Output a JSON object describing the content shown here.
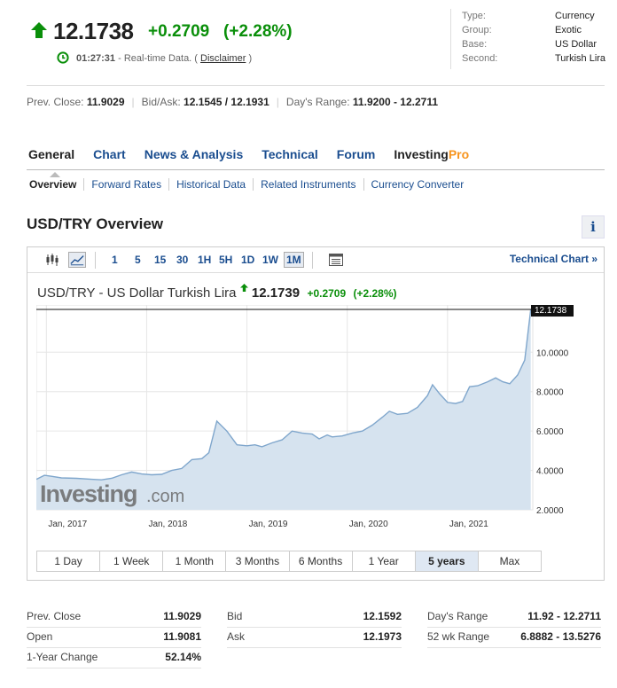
{
  "quote": {
    "price": "12.1738",
    "change": "+0.2709",
    "change_pct": "(+2.28%)",
    "time": "01:27:31",
    "realtime_text": "- Real-time Data. (",
    "disclaimer": "Disclaimer",
    "close_paren": ")",
    "up_color": "#0a8f0a"
  },
  "info": [
    {
      "k": "Type:",
      "v": "Currency"
    },
    {
      "k": "Group:",
      "v": "Exotic"
    },
    {
      "k": "Base:",
      "v": "US Dollar"
    },
    {
      "k": "Second:",
      "v": "Turkish Lira"
    }
  ],
  "stats_line": {
    "prev_close_label": "Prev. Close:",
    "prev_close": "11.9029",
    "bid_ask_label": "Bid/Ask:",
    "bid_ask": "12.1545 / 12.1931",
    "days_range_label": "Day's Range:",
    "days_range": "11.9200 - 12.2711"
  },
  "main_tabs": [
    "General",
    "Chart",
    "News & Analysis",
    "Technical",
    "Forum"
  ],
  "pro_tab": {
    "a": "Investing",
    "b": "Pro"
  },
  "sub_tabs": [
    "Overview",
    "Forward Rates",
    "Historical Data",
    "Related Instruments",
    "Currency Converter"
  ],
  "section_title": "USD/TRY Overview",
  "info_button": "i",
  "toolbar": {
    "timeframes": [
      "1",
      "5",
      "15",
      "30",
      "1H",
      "5H",
      "1D",
      "1W",
      "1M"
    ],
    "selected_timeframe": "1M",
    "technical_chart": "Technical Chart »"
  },
  "chart_title": {
    "name": "USD/TRY - US Dollar Turkish Lira",
    "price": "12.1739",
    "change": "+0.2709",
    "change_pct": "(+2.28%)"
  },
  "chart_data": {
    "type": "area",
    "title": "USD/TRY - US Dollar Turkish Lira",
    "x_ticks": [
      "Jan, 2017",
      "Jan, 2018",
      "Jan, 2019",
      "Jan, 2020",
      "Jan, 2021"
    ],
    "y_ticks": [
      "2.0000",
      "4.0000",
      "6.0000",
      "8.0000",
      "10.0000"
    ],
    "ylim": [
      2.0,
      12.4
    ],
    "xlim": [
      2016.9,
      2021.85
    ],
    "last_value_label": "12.1738",
    "last_value": 12.1738,
    "watermark": "Investing",
    "watermark_suffix": ".com",
    "grid": true,
    "fill_color": "#d6e3ef",
    "line_color": "#7fa6cc",
    "series": [
      {
        "values": [
          [
            2016.9,
            3.55
          ],
          [
            2016.98,
            3.75
          ],
          [
            2017.05,
            3.7
          ],
          [
            2017.15,
            3.62
          ],
          [
            2017.3,
            3.6
          ],
          [
            2017.45,
            3.55
          ],
          [
            2017.55,
            3.52
          ],
          [
            2017.65,
            3.6
          ],
          [
            2017.75,
            3.78
          ],
          [
            2017.85,
            3.92
          ],
          [
            2017.95,
            3.82
          ],
          [
            2018.05,
            3.78
          ],
          [
            2018.15,
            3.8
          ],
          [
            2018.25,
            4.0
          ],
          [
            2018.35,
            4.1
          ],
          [
            2018.45,
            4.55
          ],
          [
            2018.55,
            4.6
          ],
          [
            2018.62,
            4.9
          ],
          [
            2018.7,
            6.5
          ],
          [
            2018.8,
            6.0
          ],
          [
            2018.9,
            5.3
          ],
          [
            2019.0,
            5.25
          ],
          [
            2019.08,
            5.3
          ],
          [
            2019.15,
            5.2
          ],
          [
            2019.25,
            5.4
          ],
          [
            2019.35,
            5.55
          ],
          [
            2019.45,
            6.0
          ],
          [
            2019.55,
            5.9
          ],
          [
            2019.65,
            5.85
          ],
          [
            2019.72,
            5.6
          ],
          [
            2019.8,
            5.8
          ],
          [
            2019.85,
            5.7
          ],
          [
            2019.95,
            5.75
          ],
          [
            2020.05,
            5.9
          ],
          [
            2020.15,
            6.0
          ],
          [
            2020.25,
            6.3
          ],
          [
            2020.35,
            6.7
          ],
          [
            2020.42,
            7.0
          ],
          [
            2020.5,
            6.85
          ],
          [
            2020.6,
            6.9
          ],
          [
            2020.7,
            7.2
          ],
          [
            2020.8,
            7.8
          ],
          [
            2020.85,
            8.35
          ],
          [
            2020.92,
            7.9
          ],
          [
            2021.0,
            7.45
          ],
          [
            2021.08,
            7.4
          ],
          [
            2021.15,
            7.5
          ],
          [
            2021.22,
            8.25
          ],
          [
            2021.3,
            8.3
          ],
          [
            2021.4,
            8.5
          ],
          [
            2021.48,
            8.7
          ],
          [
            2021.55,
            8.5
          ],
          [
            2021.62,
            8.4
          ],
          [
            2021.7,
            8.85
          ],
          [
            2021.77,
            9.6
          ],
          [
            2021.83,
            12.17
          ]
        ]
      }
    ]
  },
  "range_buttons": [
    "1 Day",
    "1 Week",
    "1 Month",
    "3 Months",
    "6 Months",
    "1 Year",
    "5 years",
    "Max"
  ],
  "selected_range": "5 years",
  "bottom_stats": {
    "col1": [
      {
        "k": "Prev. Close",
        "v": "11.9029"
      },
      {
        "k": "Open",
        "v": "11.9081"
      },
      {
        "k": "1-Year Change",
        "v": "52.14%"
      }
    ],
    "col2": [
      {
        "k": "Bid",
        "v": "12.1592"
      },
      {
        "k": "Ask",
        "v": "12.1973"
      }
    ],
    "col3": [
      {
        "k": "Day's Range",
        "v": "11.92 - 12.2711"
      },
      {
        "k": "52 wk Range",
        "v": "6.8882 - 13.5276"
      }
    ]
  }
}
